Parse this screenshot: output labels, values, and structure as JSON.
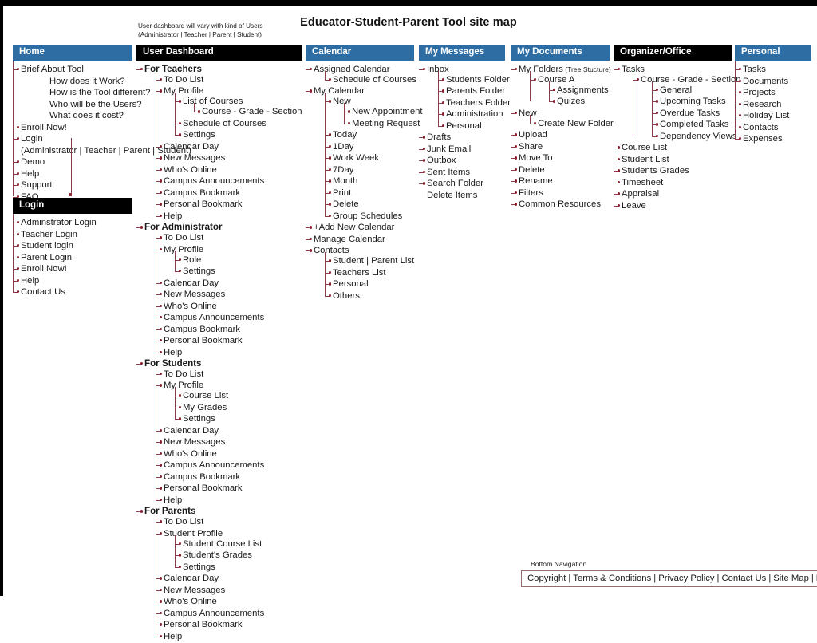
{
  "page": {
    "title": "Educator-Student-Parent Tool site map",
    "dashboard_note": "User dashboard will vary with kind of Users\n(Administrator | Teacher | Parent |  Student)"
  },
  "colors": {
    "header_blue": "#2E6DA4",
    "header_black": "#000000",
    "connector": "#8a3b4a",
    "bullet": "#8a2030",
    "text": "#1a1a1a"
  },
  "columns": {
    "home": {
      "header": "Home",
      "header_style": "blue",
      "items": [
        "Brief About Tool"
      ],
      "sub_questions": [
        "How does it Work?",
        "How is the Tool different?",
        "Who will be the Users?",
        "What does it cost?"
      ],
      "items2": [
        "Enroll Now!",
        "Login"
      ],
      "login_note": "(Administrator | Teacher | Parent |  Student)",
      "items3": [
        "Demo",
        "Help",
        "Support",
        "FAQ"
      ]
    },
    "login": {
      "header": "Login",
      "header_style": "black",
      "items": [
        "Adminstrator Login",
        "Teacher Login",
        "Student login",
        "Parent Login",
        "Enroll Now!",
        "Help",
        "Contact Us"
      ]
    },
    "dashboard": {
      "header": "User Dashboard",
      "header_style": "black",
      "groups": [
        {
          "label": "For Teachers",
          "items": [
            {
              "label": "To Do List"
            },
            {
              "label": "My Profile",
              "children": [
                {
                  "label": "List of Courses",
                  "children": [
                    {
                      "label": "Course - Grade - Section"
                    }
                  ]
                },
                {
                  "label": "Schedule of Courses"
                },
                {
                  "label": "Settings"
                }
              ]
            },
            {
              "label": "Calendar Day"
            },
            {
              "label": "New Messages"
            },
            {
              "label": "Who's Online"
            },
            {
              "label": "Campus Announcements"
            },
            {
              "label": "Campus Bookmark"
            },
            {
              "label": "Personal Bookmark"
            },
            {
              "label": "Help"
            }
          ]
        },
        {
          "label": "For Administrator",
          "items": [
            {
              "label": "To Do List"
            },
            {
              "label": "My Profile",
              "children": [
                {
                  "label": "Role"
                },
                {
                  "label": "Settings"
                }
              ]
            },
            {
              "label": "Calendar Day"
            },
            {
              "label": "New Messages"
            },
            {
              "label": "Who's Online"
            },
            {
              "label": "Campus Announcements"
            },
            {
              "label": "Campus Bookmark"
            },
            {
              "label": "Personal Bookmark"
            },
            {
              "label": "Help"
            }
          ]
        },
        {
          "label": "For Students",
          "items": [
            {
              "label": "To Do List"
            },
            {
              "label": "My Profile",
              "children": [
                {
                  "label": "Course List"
                },
                {
                  "label": "My Grades"
                },
                {
                  "label": "Settings"
                }
              ]
            },
            {
              "label": "Calendar Day"
            },
            {
              "label": "New Messages"
            },
            {
              "label": "Who's Online"
            },
            {
              "label": "Campus Announcements"
            },
            {
              "label": "Campus Bookmark"
            },
            {
              "label": "Personal Bookmark"
            },
            {
              "label": "Help"
            }
          ]
        },
        {
          "label": "For Parents",
          "items": [
            {
              "label": "To Do List"
            },
            {
              "label": "Student Profile",
              "children": [
                {
                  "label": "Student Course List"
                },
                {
                  "label": "Student's Grades"
                },
                {
                  "label": "Settings"
                }
              ]
            },
            {
              "label": "Calendar Day"
            },
            {
              "label": "New Messages"
            },
            {
              "label": "Who's Online"
            },
            {
              "label": "Campus Announcements"
            },
            {
              "label": "Personal Bookmark"
            },
            {
              "label": "Help"
            }
          ]
        }
      ]
    },
    "calendar": {
      "header": "Calendar",
      "header_style": "blue",
      "items": [
        {
          "label": "Assigned Calendar",
          "children": [
            {
              "label": "Schedule of Courses"
            }
          ]
        },
        {
          "label": "My Calendar",
          "children": [
            {
              "label": "New",
              "children": [
                {
                  "label": "New Appointment"
                },
                {
                  "label": "Meeting Request"
                }
              ]
            },
            {
              "label": "Today"
            },
            {
              "label": "1Day"
            },
            {
              "label": "Work Week"
            },
            {
              "label": "7Day"
            },
            {
              "label": "Month"
            },
            {
              "label": "Print"
            },
            {
              "label": "Delete"
            },
            {
              "label": "Group Schedules"
            }
          ]
        },
        {
          "label": "+Add New Calendar"
        },
        {
          "label": "Manage Calendar"
        },
        {
          "label": "Contacts",
          "children": [
            {
              "label": "Student | Parent List"
            },
            {
              "label": "Teachers List"
            },
            {
              "label": "Personal"
            },
            {
              "label": "Others"
            }
          ]
        }
      ]
    },
    "messages": {
      "header": "My Messages",
      "header_style": "blue",
      "items": [
        {
          "label": "Inbox",
          "children": [
            {
              "label": "Students Folder"
            },
            {
              "label": "Parents Folder"
            },
            {
              "label": "Teachers Folder"
            },
            {
              "label": "Administration"
            },
            {
              "label": "Personal"
            }
          ]
        },
        {
          "label": "Drafts"
        },
        {
          "label": "Junk Email"
        },
        {
          "label": "Outbox"
        },
        {
          "label": "Sent Items"
        },
        {
          "label": "Search Folder"
        },
        {
          "label": "Delete Items",
          "nobullet": true
        }
      ]
    },
    "documents": {
      "header": "My Documents",
      "header_style": "blue",
      "items": [
        {
          "label": "My Folders",
          "note": "(Tree Stucture)",
          "children": [
            {
              "label": "Course A",
              "children": [
                {
                  "label": "Assignments"
                },
                {
                  "label": "Quizes"
                }
              ]
            }
          ]
        },
        {
          "label": "New",
          "children": [
            {
              "label": "Create New Folder"
            }
          ]
        },
        {
          "label": "Upload"
        },
        {
          "label": "Share"
        },
        {
          "label": "Move To"
        },
        {
          "label": "Delete"
        },
        {
          "label": "Rename"
        },
        {
          "label": "Filters"
        },
        {
          "label": "Common Resources"
        }
      ]
    },
    "organizer": {
      "header": "Organizer/Office",
      "header_style": "black",
      "items": [
        {
          "label": "Tasks",
          "children": [
            {
              "label": "Course - Grade - Section",
              "children": [
                {
                  "label": "General"
                },
                {
                  "label": "Upcoming Tasks"
                },
                {
                  "label": "Overdue Tasks"
                },
                {
                  "label": "Completed Tasks"
                },
                {
                  "label": "Dependency Views"
                }
              ]
            }
          ]
        },
        {
          "label": "Course List"
        },
        {
          "label": "Student List"
        },
        {
          "label": "Students Grades"
        },
        {
          "label": "Timesheet"
        },
        {
          "label": "Appraisal"
        },
        {
          "label": "Leave"
        }
      ]
    },
    "personal": {
      "header": "Personal",
      "header_style": "blue",
      "items": [
        {
          "label": "Tasks"
        },
        {
          "label": "Documents"
        },
        {
          "label": "Projects"
        },
        {
          "label": "Research"
        },
        {
          "label": "Holiday List"
        },
        {
          "label": "Contacts"
        },
        {
          "label": "Expenses"
        }
      ]
    }
  },
  "bottom_navigation": {
    "label": "Bottom Navigation",
    "links": [
      "Copyright",
      "Terms & Conditions",
      "Privacy Policy",
      "Contact Us",
      "Site Map",
      "FAQ"
    ],
    "separator": "|"
  }
}
